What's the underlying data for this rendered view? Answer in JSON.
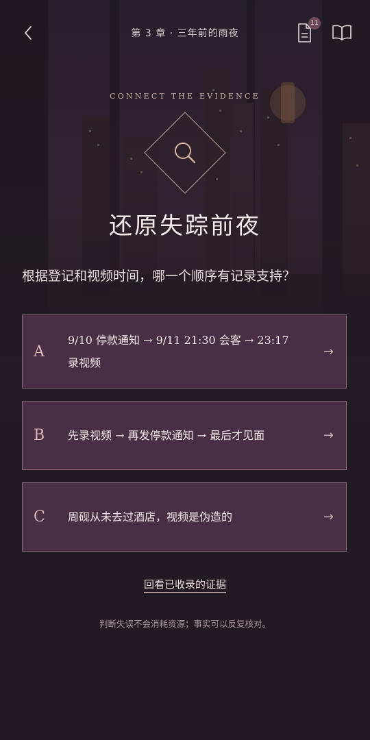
{
  "header": {
    "chapter_title": "第 3 章 · 三年前的雨夜",
    "notes_badge": "11",
    "icons": {
      "back": "chevron-left-icon",
      "notes": "document-icon",
      "book": "open-book-icon"
    }
  },
  "puzzle": {
    "subtitle": "CONNECT THE EVIDENCE",
    "icon": "magnifier-icon",
    "title": "还原失踪前夜",
    "question": "根据登记和视频时间，哪一个顺序有记录支持？"
  },
  "options": [
    {
      "letter": "A",
      "text": "9/10 停款通知 → 9/11 21:30 会客 → 23:17 录视频",
      "arrow": "→"
    },
    {
      "letter": "B",
      "text": "先录视频 → 再发停款通知 → 最后才见面",
      "arrow": "→"
    },
    {
      "letter": "C",
      "text": "周砚从未去过酒店，视频是伪造的",
      "arrow": "→"
    }
  ],
  "review_link": "回看已收录的证据",
  "footnote": "判断失误不会消耗资源；事实可以反复核对。",
  "colors": {
    "background": "#211a22",
    "option_fill": "#4a2f44",
    "option_border": "#8b6a7c",
    "accent": "#c9b4a6"
  }
}
